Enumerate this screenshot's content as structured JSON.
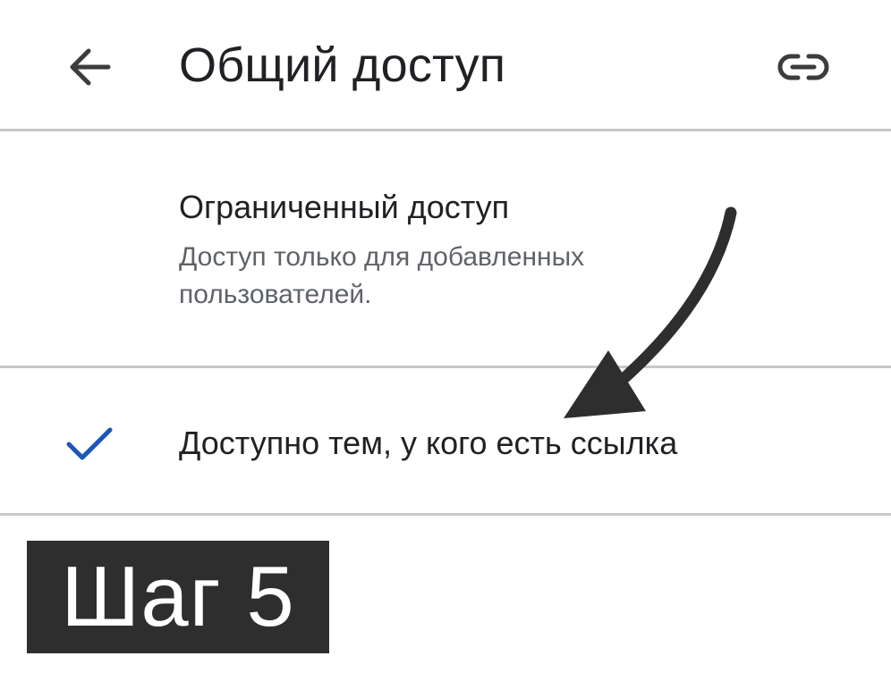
{
  "header": {
    "title": "Общий доступ",
    "back_icon": "arrow-left-icon",
    "link_icon": "link-icon"
  },
  "options": [
    {
      "title": "Ограниченный доступ",
      "description": "Доступ только для добавленных пользователей.",
      "selected": false
    },
    {
      "title": "Доступно тем, у кого есть ссылка",
      "selected": true,
      "check_icon": "checkmark-icon"
    }
  ],
  "annotation": {
    "step_label": "Шаг 5",
    "arrow_icon": "curved-arrow-icon"
  },
  "colors": {
    "text": "#202124",
    "secondary_text": "#5f6368",
    "divider": "#c8c8c8",
    "check": "#1a57b8",
    "badge_bg": "#2e2e2e",
    "badge_text": "#ffffff"
  }
}
